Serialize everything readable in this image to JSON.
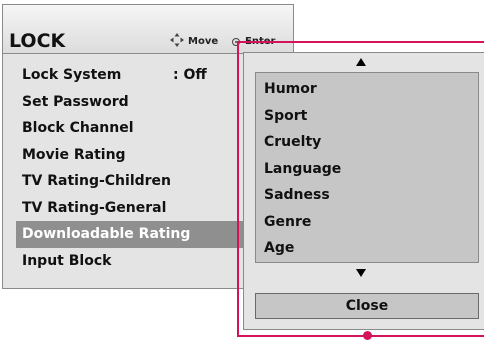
{
  "menu": {
    "title": "LOCK",
    "hints": {
      "move_label": "Move",
      "enter_label": "Enter"
    },
    "items": [
      {
        "label": "Lock System",
        "value": ": Off"
      },
      {
        "label": "Set Password"
      },
      {
        "label": "Block Channel"
      },
      {
        "label": "Movie Rating"
      },
      {
        "label": "TV Rating-Children"
      },
      {
        "label": "TV Rating-General"
      },
      {
        "label": "Downloadable Rating",
        "selected": true
      },
      {
        "label": "Input Block"
      }
    ]
  },
  "submenu": {
    "options": [
      "Humor",
      "Sport",
      "Cruelty",
      "Language",
      "Sadness",
      "Genre",
      "Age"
    ],
    "close_label": "Close"
  },
  "colors": {
    "highlight": "#d4145a",
    "selected_bg": "#8f8f8f"
  },
  "icons": {
    "move": "move-arrows-icon",
    "enter": "enter-circle-icon",
    "scroll_up": "triangle-up-icon",
    "scroll_down": "triangle-down-icon"
  }
}
